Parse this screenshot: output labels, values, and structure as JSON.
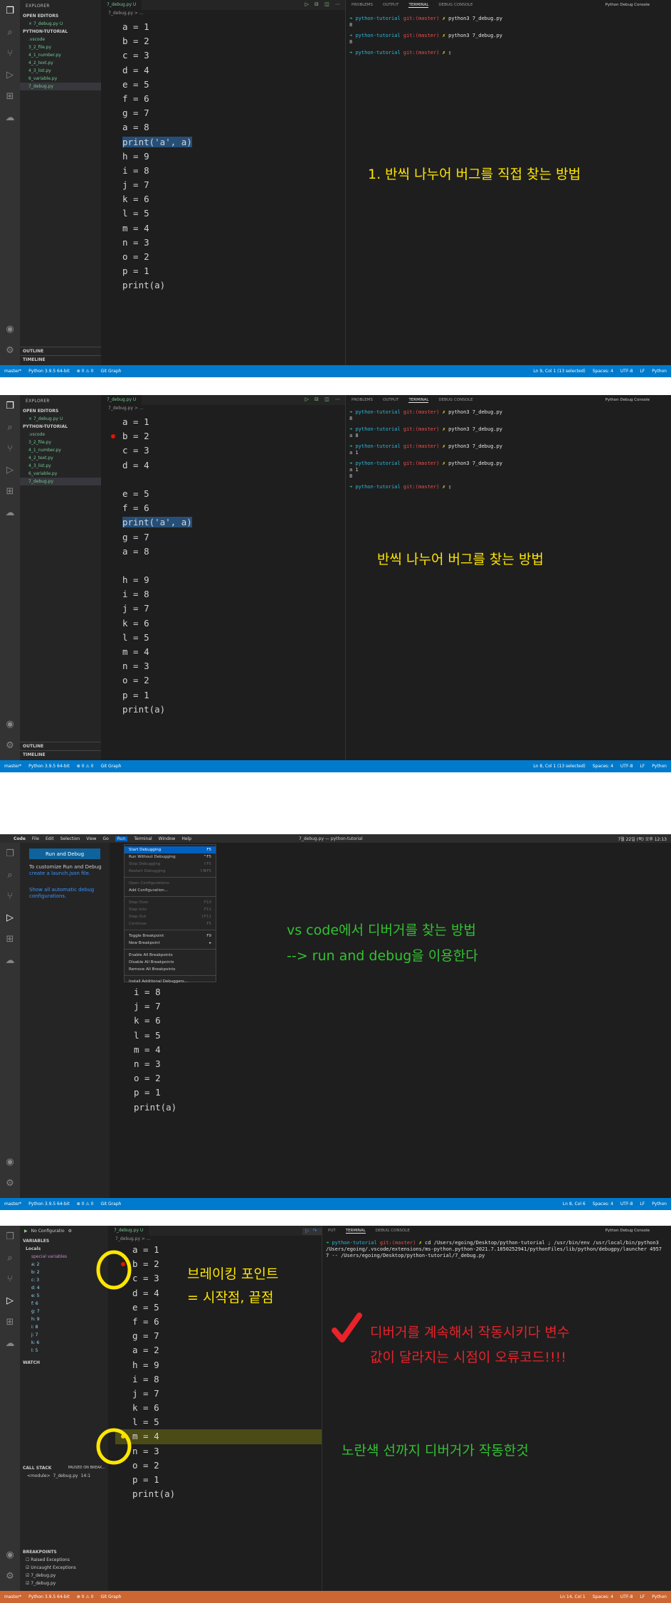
{
  "p1": {
    "side": {
      "title": "EXPLORER",
      "open_editors": "OPEN EDITORS",
      "open_file": "7_debug.py",
      "open_file_status": "U",
      "project": "PYTHON-TUTORIAL",
      "files": [
        {
          "n": ".vscode"
        },
        {
          "n": "3_2_file.py"
        },
        {
          "n": "4_1_number.py"
        },
        {
          "n": "4_2_text.py"
        },
        {
          "n": "4_3_list.py"
        },
        {
          "n": "6_variable.py"
        },
        {
          "n": "7_debug.py",
          "s": "U"
        }
      ],
      "outline": "OUTLINE",
      "timeline": "TIMELINE"
    },
    "tab": "7_debug.py U",
    "breadcrumb": "7_debug.py > ...",
    "code": [
      "a = 1",
      "b = 2",
      "c = 3",
      "d = 4",
      "e = 5",
      "f = 6",
      "g = 7",
      "a = 8",
      "print('a', a)",
      "h = 9",
      "i = 8",
      "j = 7",
      "k = 6",
      "l = 5",
      "m = 4",
      "n = 3",
      "o = 2",
      "p = 1",
      "print(a)"
    ],
    "terminal": {
      "tabs": [
        "PROBLEMS",
        "OUTPUT",
        "TERMINAL",
        "DEBUG CONSOLE"
      ],
      "console": "Python Debug Console",
      "lines": [
        {
          "p": "python-tutorial",
          "b": "git:(master)",
          "c": "python3 7_debug.py"
        },
        {
          "o": "8"
        },
        {
          "p": "python-tutorial",
          "b": "git:(master)",
          "c": "python3 7_debug.py"
        },
        {
          "o": "8"
        },
        {
          "p": "python-tutorial",
          "b": "git:(master)",
          "c": ""
        }
      ]
    },
    "annotation": "1. 반씩 나누어 버그를 직접 찾는 방법",
    "status": {
      "branch": "master*",
      "python": "Python 3.9.5 64-bit",
      "errors": "⊗ 0 ⚠ 0",
      "git": "Git Graph",
      "pos": "Ln 9, Col 1 (13 selected)",
      "spaces": "Spaces: 4",
      "enc": "UTF-8",
      "eol": "LF",
      "lang": "Python"
    }
  },
  "p2": {
    "side": {
      "title": "EXPLORER",
      "open_editors": "OPEN EDITORS",
      "open_file": "7_debug.py",
      "open_file_status": "U",
      "project": "PYTHON-TUTORIAL",
      "files": [
        {
          "n": ".vscode"
        },
        {
          "n": "3_2_file.py"
        },
        {
          "n": "4_1_number.py"
        },
        {
          "n": "4_2_text.py"
        },
        {
          "n": "4_3_list.py"
        },
        {
          "n": "6_variable.py"
        },
        {
          "n": "7_debug.py",
          "s": "U"
        }
      ],
      "outline": "OUTLINE",
      "timeline": "TIMELINE"
    },
    "tab": "7_debug.py U",
    "breadcrumb": "7_debug.py > ...",
    "code": [
      "a = 1",
      "b = 2",
      "c = 3",
      "d = 4",
      "",
      "e = 5",
      "f = 6",
      "print('a', a)",
      "g = 7",
      "a = 8",
      "",
      "h = 9",
      "i = 8",
      "j = 7",
      "k = 6",
      "l = 5",
      "m = 4",
      "n = 3",
      "o = 2",
      "p = 1",
      "print(a)"
    ],
    "terminal": {
      "tabs": [
        "PROBLEMS",
        "OUTPUT",
        "TERMINAL",
        "DEBUG CONSOLE"
      ],
      "console": "Python Debug Console",
      "lines": [
        {
          "p": "python-tutorial",
          "b": "git:(master)",
          "c": "python3 7_debug.py"
        },
        {
          "o": "8"
        },
        {
          "p": "python-tutorial",
          "b": "git:(master)",
          "c": "python3 7_debug.py"
        },
        {
          "o": "a 8"
        },
        {
          "p": "python-tutorial",
          "b": "git:(master)",
          "c": "python3 7_debug.py"
        },
        {
          "o": "a 1"
        },
        {
          "p": "python-tutorial",
          "b": "git:(master)",
          "c": "python3 7_debug.py"
        },
        {
          "o": "a 1"
        },
        {
          "o": "8"
        },
        {
          "p": "python-tutorial",
          "b": "git:(master)",
          "c": ""
        }
      ]
    },
    "annotation": "반씩 나누어 버그를 찾는 방법",
    "status": {
      "branch": "master*",
      "python": "Python 3.9.5 64-bit",
      "errors": "⊗ 0 ⚠ 0",
      "git": "Git Graph",
      "pos": "Ln 8, Col 1 (13 selected)",
      "spaces": "Spaces: 4",
      "enc": "UTF-8",
      "eol": "LF",
      "lang": "Python"
    }
  },
  "p3": {
    "menubar": [
      "Code",
      "File",
      "Edit",
      "Selection",
      "View",
      "Go",
      "Run",
      "Terminal",
      "Window",
      "Help"
    ],
    "window_title": "7_debug.py — python-tutorial",
    "clock": "7월 22일 (목) 오후 12:13",
    "run_button": "Run and Debug",
    "customize": "To customize Run and Debug",
    "launch_link": "create a launch.json file.",
    "show_link": "Show all automatic debug configurations.",
    "menu": [
      {
        "l": "Start Debugging",
        "k": "F5",
        "on": true
      },
      {
        "l": "Run Without Debugging",
        "k": "^F5"
      },
      {
        "l": "Stop Debugging",
        "k": "⇧F5",
        "d": true
      },
      {
        "l": "Restart Debugging",
        "k": "⇧⌘F5",
        "d": true
      },
      {
        "sep": true
      },
      {
        "l": "Open Configurations",
        "d": true
      },
      {
        "l": "Add Configuration..."
      },
      {
        "sep": true
      },
      {
        "l": "Step Over",
        "k": "F10",
        "d": true
      },
      {
        "l": "Step Into",
        "k": "F11",
        "d": true
      },
      {
        "l": "Step Out",
        "k": "⇧F11",
        "d": true
      },
      {
        "l": "Continue",
        "k": "F5",
        "d": true
      },
      {
        "sep": true
      },
      {
        "l": "Toggle Breakpoint",
        "k": "F9"
      },
      {
        "l": "New Breakpoint",
        "k": "▸"
      },
      {
        "sep": true
      },
      {
        "l": "Enable All Breakpoints"
      },
      {
        "l": "Disable All Breakpoints"
      },
      {
        "l": "Remove All Breakpoints"
      },
      {
        "sep": true
      },
      {
        "l": "Install Additional Debuggers..."
      }
    ],
    "code": [
      "i = 8",
      "j = 7",
      "k = 6",
      "l = 5",
      "m = 4",
      "n = 3",
      "o = 2",
      "p = 1",
      "print(a)"
    ],
    "annotation1": "vs code에서 디버거를 찾는 방법",
    "annotation2": "--> run and debug을 이용한다",
    "status": {
      "branch": "master*",
      "python": "Python 3.9.5 64-bit",
      "errors": "⊗ 0 ⚠ 0",
      "git": "Git Graph",
      "pos": "Ln 8, Col 6",
      "spaces": "Spaces: 4",
      "enc": "UTF-8",
      "eol": "LF",
      "lang": "Python"
    }
  },
  "p4": {
    "config": "No Configuratio",
    "tab": "7_debug.py U",
    "breadcrumb": "7_debug.py > ...",
    "vars_title": "VARIABLES",
    "locals": "Locals",
    "special": "special variables",
    "vars": [
      "a: 2",
      "b: 2",
      "c: 3",
      "d: 4",
      "e: 5",
      "f: 6",
      "g: 7",
      "h: 9",
      "i: 8",
      "j: 7",
      "k: 6",
      "l: 5"
    ],
    "watch": "WATCH",
    "callstack": "CALL STACK",
    "paused": "PAUSED ON BREAK...",
    "frame": "<module>",
    "frame_file": "7_debug.py",
    "frame_line": "14:1",
    "breakpoints": "BREAKPOINTS",
    "bps": [
      "Raised Exceptions",
      "Uncaught Exceptions",
      "7_debug.py",
      "7_debug.py"
    ],
    "code": [
      "a = 1",
      "b = 2",
      "c = 3",
      "d = 4",
      "e = 5",
      "f = 6",
      "g = 7",
      "a = 2",
      "h = 9",
      "i = 8",
      "j = 7",
      "k = 6",
      "l = 5",
      "m = 4",
      "n = 3",
      "o = 2",
      "p = 1",
      "print(a)"
    ],
    "terminal": {
      "tabs": [
        "PUT",
        "TERMINAL",
        "DEBUG CONSOLE"
      ],
      "console": "Python Debug Console",
      "prompt": "python-tutorial",
      "branch": "git:(master)",
      "cmd": "cd /Users/egoing/Desktop/python-tutorial ; /usr/bin/env /usr/local/bin/python3 /Users/egoing/.vscode/extensions/ms-python.python-2021.7.1050252941/pythonFiles/lib/python/debugpy/launcher 49577 -- /Users/egoing/Desktop/python-tutorial/7_debug.py"
    },
    "ann_bp1": "브레이킹 포인트",
    "ann_bp2": "= 시작점, 끝점",
    "ann_red1": "디버거를 계속해서 작동시키다 변수",
    "ann_red2": "값이 달라지는 시점이 오류코드!!!!",
    "ann_yellow": "노란색 선까지 디버거가 작동한것",
    "status": {
      "branch": "master*",
      "python": "Python 3.9.5 64-bit",
      "errors": "⊗ 0 ⚠ 0",
      "git": "Git Graph",
      "pos": "Ln 14, Col 1",
      "spaces": "Spaces: 4",
      "enc": "UTF-8",
      "eol": "LF",
      "lang": "Python"
    }
  },
  "colors": {
    "green_note": "#32c232",
    "yellow_note": "#ffe600",
    "red_note": "#e8232a"
  }
}
